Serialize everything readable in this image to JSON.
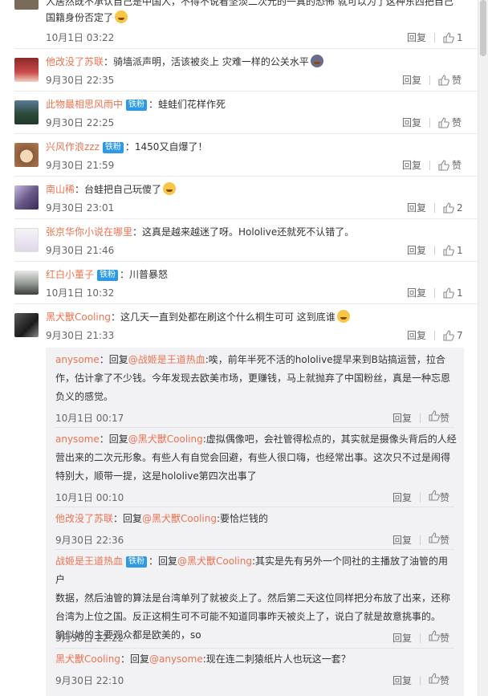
{
  "top_partial": {
    "line1": "人居然既不承认自己是中国人，不得不说看坚淡二次元的一真的恐怖 就可以为了这种东西把自己",
    "line2": "国籍身份否定了",
    "date": "10月1日 03:22",
    "reply_label": "回复",
    "likes": "1"
  },
  "comments": [
    {
      "user": "他改没了苏联",
      "badge": "",
      "text": "：骑墙派声明，活该被炎上 灾难一样的公关水平",
      "date": "9月30日 22:35",
      "reply_label": "回复",
      "likes": "赞"
    },
    {
      "user": "此物最相思风雨中",
      "badge": "铁粉",
      "text": "：蛙蛙们花样作死",
      "date": "9月30日 22:25",
      "reply_label": "回复",
      "likes": "赞"
    },
    {
      "user": "兴风作浪zzz",
      "badge": "铁粉",
      "text": "：1450又自爆了！",
      "date": "9月30日 21:59",
      "reply_label": "回复",
      "likes": "赞"
    },
    {
      "user": "南山稀",
      "badge": "",
      "text": "：台蛙把自己玩傻了",
      "date": "9月30日 23:01",
      "reply_label": "回复",
      "likes": "2"
    },
    {
      "user": "张京华你小说在哪里",
      "badge": "",
      "text": "：这真是越来越迷了呀。Hololive还就死不认错了。",
      "date": "9月30日 21:46",
      "reply_label": "回复",
      "likes": "1"
    },
    {
      "user": "红白小董子",
      "badge": "铁粉",
      "text": "：川普暴怒",
      "date": "10月1日 10:32",
      "reply_label": "回复",
      "likes": "1"
    },
    {
      "user": "黑犬獸Cooling",
      "badge": "",
      "text": "：这几天一直到处都在刷这个什么桐生可可 这到底谁",
      "date": "9月30日 21:33",
      "reply_label": "回复",
      "likes": "7"
    }
  ],
  "replies": [
    {
      "user": "anysome",
      "badge": "",
      "prefix": "：回复",
      "mention": "@战姬是王道热血",
      "lines": [
        ":唉，前年半死不活的hololive提早来到B站搞运营，拉合",
        "作，估计拿了不少钱。今年发现去欧美市场，更赚钱，马上就抛弃了中国粉丝，真是一种忘恩",
        "负义的感觉。"
      ],
      "date": "10月1日 00:17",
      "reply_label": "回复",
      "likes": "赞"
    },
    {
      "user": "anysome",
      "badge": "",
      "prefix": "：回复",
      "mention": "@黑犬獸Cooling",
      "lines": [
        ":虚拟偶像吧，会社管得松点的，其实就是摄像头背后的人经",
        "营出来的二次元形象。有些人有自觉会回避，有些人很口嗨，也经常出事。这次只不过是闹得",
        "特别大，顺带一提，这是hololive第四次出事了"
      ],
      "date": "10月1日 00:10",
      "reply_label": "回复",
      "likes": "赞"
    },
    {
      "user": "他改没了苏联",
      "badge": "",
      "prefix": "：回复",
      "mention": "@黑犬獸Cooling",
      "lines": [
        ":要恰烂钱的"
      ],
      "date": "9月30日 22:36",
      "reply_label": "回复",
      "likes": "赞"
    },
    {
      "user": "战姬是王道热血",
      "badge": "铁粉",
      "prefix": "：回复",
      "mention": "@黑犬獸Cooling",
      "lines": [
        ":其实是先有另外一个同社的主播放了油管的用户",
        "数据，然后油管的算法是台湾单列了就被炎上了。然后第二天这位同样把分布放了出来，还称",
        "台湾为上位之国。反正这桐生可不可能不知道同事昨天被炎上了，说白了就是故意挑事的。",
        "貌似她的主要观众都是欧美的，so"
      ],
      "date": "9月30日 22:22",
      "reply_label": "回复",
      "likes": "赞"
    },
    {
      "user": "黑犬獸Cooling",
      "badge": "",
      "prefix": "：回复",
      "mention": "@anysome",
      "lines": [
        ":现在连二刺猿纸片人也玩这一套？"
      ],
      "date": "9月30日 22:10",
      "reply_label": "回复",
      "likes": "赞"
    }
  ],
  "colors": {
    "username": "#eb7350",
    "badge": "#2e9ae5",
    "meta": "#666666",
    "reply_bg": "#f2f2f5"
  }
}
